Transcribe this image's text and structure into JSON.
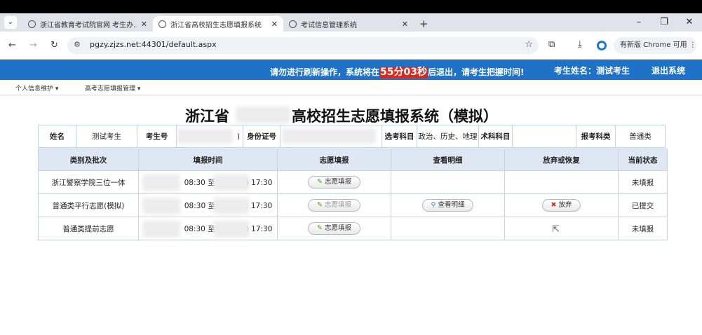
{
  "browser": {
    "tabs": [
      {
        "title": "浙江省教育考试院官网 考生办…",
        "active": false
      },
      {
        "title": "浙江省高校招生志愿填报系统",
        "active": true
      },
      {
        "title": "考试信息管理系统",
        "active": false
      }
    ],
    "url_scheme_hidden": "",
    "url": "pgzy.zjzs.net:44301/default.aspx",
    "chrome_button": "有新版 Chrome 可用"
  },
  "banner": {
    "warn_prefix": "请勿进行刷新操作，系统将在",
    "countdown": "55分03秒",
    "warn_suffix": "后退出，请考生把握时间!",
    "student_label": "考生姓名：测试考生",
    "logout": "退出系统"
  },
  "menu": {
    "item1": "个人信息维护 ▾",
    "item2": "高考志愿填报管理 ▾"
  },
  "page": {
    "title_left": "浙江省",
    "title_right": "高校招生志愿填报系统（模拟）"
  },
  "info": {
    "name_label": "姓名",
    "name_value": "测试考生",
    "exam_no_label": "考生号",
    "exam_no_value": ")",
    "id_label": "身份证号",
    "subjects_label": "选考科目",
    "subjects_value": "政治、历史、地理",
    "skill_label": "术科科目",
    "category_label": "报考科类",
    "category_value": "普通类"
  },
  "table": {
    "headers": [
      "类别及批次",
      "填报时间",
      "志愿填报",
      "查看明细",
      "放弃或恢复",
      "当前状态"
    ],
    "rows": [
      {
        "batch": "浙江警察学院三位一体",
        "time_start": "08:30 至",
        "time_end": ") 17:30",
        "fill": "志愿填报",
        "detail": "",
        "abandon": "",
        "status": "未填报"
      },
      {
        "batch": "普通类平行志愿(模拟)",
        "time_start": "08:30 至",
        "time_end": "; 17:30",
        "fill": "志愿填报",
        "detail": "查看明细",
        "abandon": "放弃",
        "status": "已提交"
      },
      {
        "batch": "普通类提前志愿",
        "time_start": "08:30 至",
        "time_end": ") 17:30",
        "fill": "志愿填报",
        "detail": "",
        "abandon": "",
        "status": "未填报"
      }
    ]
  },
  "colors": {
    "banner": "#1e73c8",
    "countdown_bg": "#e0251a",
    "header_row": "#dfe7f3"
  }
}
